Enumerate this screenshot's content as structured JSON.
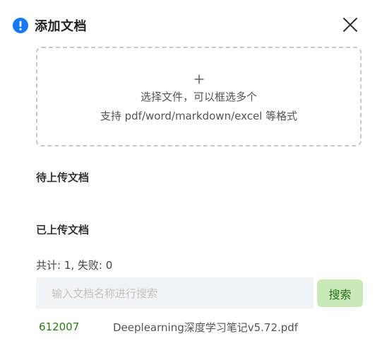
{
  "dialog": {
    "title": "添加文档",
    "icons": {
      "title_icon": "info-circle-icon",
      "close_icon": "close-icon",
      "upload_icon": "plus-icon"
    },
    "colors": {
      "info_icon": "#1677ff",
      "search_button_bg": "#c9eab8",
      "search_button_text": "#2b6e1a",
      "file_id": "#2c7a1a"
    }
  },
  "upload": {
    "line1": "选择文件，可以框选多个",
    "line2": "支持 pdf/word/markdown/excel 等格式"
  },
  "pending": {
    "title": "待上传文档"
  },
  "uploaded": {
    "title": "已上传文档",
    "stats": "共计: 1, 失败: 0",
    "search": {
      "placeholder": "输入文档名称进行搜索",
      "value": "",
      "button_label": "搜索"
    },
    "files": [
      {
        "id": "612007",
        "name": "Deeplearning深度学习笔记v5.72.pdf"
      }
    ]
  }
}
